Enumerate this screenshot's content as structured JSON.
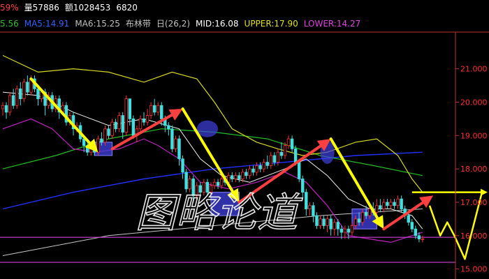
{
  "info": {
    "line1": [
      {
        "text": "59%",
        "color": "#ff4040"
      },
      {
        "text": "量57886",
        "color": "#ffffff"
      },
      {
        "text": "额1028453",
        "color": "#ffffff"
      },
      {
        "text": "6820",
        "color": "#ffffff"
      }
    ],
    "line2": [
      {
        "text": "5.56",
        "color": "#30c030"
      },
      {
        "text": "MA5:14.91",
        "color": "#3060ff"
      },
      {
        "text": "MA6:15.25",
        "color": "#c0c0c0"
      },
      {
        "text": "布林带",
        "color": "#c0c0c0"
      },
      {
        "text": "日(26,2)",
        "color": "#c0c0c0"
      },
      {
        "text": "MID:16.08",
        "color": "#ffffff"
      },
      {
        "text": "UPPER:17.90",
        "color": "#e0e020"
      },
      {
        "text": "LOWER:14.27",
        "color": "#e040e0"
      }
    ]
  },
  "watermark": "图略论道",
  "colors": {
    "background": "#000000",
    "up_candle": "#ff3030",
    "down_candle": "#40e0e0",
    "upper_band": "#d8d820",
    "lower_band": "#c020c0",
    "mid_band": "#f0f0f0",
    "ma_green": "#20c020",
    "ma_blue": "#2030ff",
    "ma_white": "#c8c8c8",
    "support_line": "#d040d0",
    "arrow_yellow": "#ffff00",
    "arrow_red": "#ff4040",
    "box_fill": "#4040e0",
    "axis_text": "#ff3030"
  },
  "chart_data": {
    "type": "candlestick",
    "y_axis": {
      "ticks": [
        {
          "value": 21.0,
          "label": "21.000"
        },
        {
          "value": 20.0,
          "label": "20.000"
        },
        {
          "value": 19.0,
          "label": "19.000"
        },
        {
          "value": 18.0,
          "label": "18.000"
        },
        {
          "value": 17.0,
          "label": "17.000"
        },
        {
          "value": 16.0,
          "label": "16.000"
        },
        {
          "value": 15.0,
          "label": "15.000"
        }
      ],
      "ylim": [
        14.7,
        22.1
      ]
    },
    "n_candles": 120,
    "candles": [
      [
        19.8,
        19.9,
        19.6,
        20.0
      ],
      [
        19.9,
        19.7,
        19.5,
        20.0
      ],
      [
        19.7,
        20.2,
        19.6,
        20.3
      ],
      [
        20.2,
        19.9,
        19.8,
        20.4
      ],
      [
        19.9,
        20.4,
        19.8,
        20.5
      ],
      [
        20.4,
        20.1,
        19.9,
        20.6
      ],
      [
        20.1,
        20.6,
        20.0,
        20.7
      ],
      [
        20.6,
        20.3,
        20.2,
        20.8
      ],
      [
        20.3,
        20.7,
        20.2,
        20.8
      ],
      [
        20.7,
        20.4,
        20.3,
        20.8
      ],
      [
        20.4,
        20.1,
        19.9,
        20.5
      ],
      [
        20.1,
        20.3,
        20.0,
        20.4
      ],
      [
        20.3,
        19.9,
        19.6,
        20.4
      ],
      [
        19.9,
        20.2,
        19.8,
        20.3
      ],
      [
        20.2,
        19.8,
        19.7,
        20.3
      ],
      [
        19.8,
        20.1,
        19.7,
        20.2
      ],
      [
        20.1,
        19.7,
        19.5,
        20.2
      ],
      [
        19.7,
        19.9,
        19.6,
        20.0
      ],
      [
        19.9,
        19.4,
        19.3,
        20.0
      ],
      [
        19.4,
        19.6,
        19.3,
        19.7
      ],
      [
        19.6,
        19.2,
        19.0,
        19.7
      ],
      [
        19.2,
        19.3,
        19.1,
        19.4
      ],
      [
        19.3,
        18.9,
        18.8,
        19.4
      ],
      [
        18.9,
        18.7,
        18.5,
        19.0
      ],
      [
        18.7,
        18.5,
        18.4,
        18.9
      ],
      [
        18.5,
        18.7,
        18.4,
        18.8
      ],
      [
        18.7,
        18.5,
        18.4,
        18.8
      ],
      [
        18.5,
        18.9,
        18.4,
        19.0
      ],
      [
        18.9,
        18.8,
        18.7,
        19.1
      ],
      [
        18.8,
        19.2,
        18.7,
        19.3
      ],
      [
        19.2,
        19.0,
        18.9,
        19.3
      ],
      [
        19.0,
        19.4,
        18.9,
        19.5
      ],
      [
        19.4,
        19.2,
        19.1,
        19.5
      ],
      [
        19.2,
        19.6,
        19.1,
        19.7
      ],
      [
        19.6,
        19.1,
        18.9,
        19.7
      ],
      [
        19.1,
        20.1,
        19.0,
        20.2
      ],
      [
        20.1,
        19.5,
        19.3,
        20.1
      ],
      [
        19.5,
        19.0,
        18.9,
        19.6
      ],
      [
        19.0,
        19.2,
        18.8,
        19.3
      ],
      [
        19.2,
        19.5,
        19.1,
        19.6
      ],
      [
        19.5,
        19.4,
        19.3,
        19.7
      ],
      [
        19.4,
        19.6,
        19.3,
        19.8
      ],
      [
        19.6,
        19.9,
        19.5,
        20.0
      ],
      [
        19.9,
        19.7,
        19.6,
        20.1
      ],
      [
        19.7,
        19.9,
        19.6,
        20.0
      ],
      [
        19.9,
        19.5,
        19.3,
        20.0
      ],
      [
        19.5,
        19.3,
        19.1,
        19.6
      ],
      [
        19.3,
        19.2,
        19.0,
        19.4
      ],
      [
        19.2,
        18.6,
        18.5,
        19.3
      ],
      [
        18.6,
        18.9,
        18.5,
        19.0
      ],
      [
        18.9,
        18.3,
        18.1,
        19.0
      ],
      [
        18.3,
        17.9,
        17.7,
        18.4
      ],
      [
        17.9,
        17.4,
        17.3,
        18.0
      ],
      [
        17.4,
        17.7,
        17.3,
        17.8
      ],
      [
        17.7,
        17.2,
        17.0,
        17.8
      ],
      [
        17.2,
        17.5,
        17.1,
        17.6
      ],
      [
        17.5,
        17.3,
        17.2,
        17.6
      ],
      [
        17.3,
        17.6,
        17.2,
        17.7
      ],
      [
        17.6,
        17.3,
        17.2,
        17.7
      ],
      [
        17.3,
        17.5,
        17.2,
        17.6
      ],
      [
        17.5,
        17.6,
        17.4,
        17.7
      ],
      [
        17.6,
        17.5,
        17.4,
        17.7
      ],
      [
        17.5,
        17.7,
        17.4,
        17.8
      ],
      [
        17.7,
        17.6,
        17.5,
        17.8
      ],
      [
        17.6,
        17.8,
        17.5,
        17.9
      ],
      [
        17.8,
        17.7,
        17.6,
        17.9
      ],
      [
        17.7,
        17.8,
        17.6,
        17.9
      ],
      [
        17.8,
        17.7,
        17.6,
        17.9
      ],
      [
        17.7,
        17.9,
        17.6,
        18.0
      ],
      [
        17.9,
        17.8,
        17.7,
        18.0
      ],
      [
        17.8,
        18.0,
        17.7,
        18.1
      ],
      [
        18.0,
        17.9,
        17.8,
        18.1
      ],
      [
        17.9,
        18.1,
        17.8,
        18.2
      ],
      [
        18.1,
        18.0,
        17.9,
        18.2
      ],
      [
        18.0,
        18.2,
        17.9,
        18.3
      ],
      [
        18.2,
        18.1,
        18.0,
        18.4
      ],
      [
        18.1,
        18.4,
        18.0,
        18.5
      ],
      [
        18.4,
        18.2,
        18.1,
        18.5
      ],
      [
        18.2,
        18.5,
        18.1,
        18.6
      ],
      [
        18.5,
        18.4,
        18.3,
        18.8
      ],
      [
        18.4,
        18.7,
        18.3,
        18.8
      ],
      [
        18.7,
        18.9,
        18.6,
        19.0
      ],
      [
        18.9,
        18.6,
        18.5,
        19.0
      ],
      [
        18.6,
        18.2,
        18.1,
        18.7
      ],
      [
        18.2,
        17.7,
        17.6,
        18.3
      ],
      [
        17.7,
        17.3,
        17.1,
        17.8
      ],
      [
        17.3,
        16.8,
        16.6,
        17.4
      ],
      [
        16.8,
        16.9,
        16.6,
        17.0
      ],
      [
        16.9,
        16.6,
        16.4,
        17.0
      ],
      [
        16.6,
        16.3,
        16.2,
        16.7
      ],
      [
        16.3,
        16.5,
        16.2,
        16.6
      ],
      [
        16.5,
        16.3,
        16.2,
        16.6
      ],
      [
        16.3,
        16.5,
        16.1,
        16.6
      ],
      [
        16.5,
        16.2,
        16.0,
        16.6
      ],
      [
        16.2,
        16.4,
        16.0,
        16.5
      ],
      [
        16.4,
        16.2,
        16.0,
        16.5
      ],
      [
        16.2,
        16.1,
        15.9,
        16.3
      ],
      [
        16.1,
        16.2,
        15.9,
        16.3
      ],
      [
        16.2,
        16.1,
        15.9,
        16.3
      ],
      [
        16.1,
        16.3,
        16.0,
        16.4
      ],
      [
        16.3,
        16.5,
        16.2,
        16.6
      ],
      [
        16.5,
        16.4,
        16.3,
        16.7
      ],
      [
        16.4,
        16.7,
        16.3,
        16.8
      ],
      [
        16.7,
        16.6,
        16.5,
        16.9
      ],
      [
        16.6,
        16.8,
        16.5,
        16.9
      ],
      [
        16.8,
        16.7,
        16.6,
        17.0
      ],
      [
        16.7,
        16.9,
        16.6,
        17.1
      ],
      [
        16.9,
        16.8,
        16.7,
        17.1
      ],
      [
        16.8,
        17.0,
        16.7,
        17.1
      ],
      [
        17.0,
        16.9,
        16.8,
        17.1
      ],
      [
        16.9,
        17.0,
        16.8,
        17.1
      ],
      [
        17.0,
        16.9,
        16.8,
        17.1
      ],
      [
        16.9,
        17.1,
        16.8,
        17.2
      ],
      [
        17.1,
        16.8,
        16.7,
        17.2
      ],
      [
        16.8,
        16.6,
        16.5,
        16.9
      ],
      [
        16.6,
        16.4,
        16.3,
        16.7
      ],
      [
        16.4,
        16.2,
        16.1,
        16.5
      ],
      [
        16.2,
        16.0,
        15.9,
        16.3
      ],
      [
        16.0,
        15.9,
        15.8,
        16.1
      ],
      [
        15.9,
        15.9,
        15.8,
        16.0
      ]
    ],
    "bollinger_upper": [
      [
        0,
        21.4
      ],
      [
        10,
        20.9
      ],
      [
        20,
        21.0
      ],
      [
        30,
        20.9
      ],
      [
        40,
        20.6
      ],
      [
        48,
        20.9
      ],
      [
        55,
        20.7
      ],
      [
        60,
        20.0
      ],
      [
        65,
        19.2
      ],
      [
        72,
        18.8
      ],
      [
        78,
        18.6
      ],
      [
        85,
        18.4
      ],
      [
        92,
        18.5
      ],
      [
        100,
        18.8
      ],
      [
        106,
        18.9
      ],
      [
        112,
        18.4
      ],
      [
        116,
        17.7
      ],
      [
        119,
        17.3
      ]
    ],
    "bollinger_lower": [
      [
        0,
        19.2
      ],
      [
        8,
        19.5
      ],
      [
        14,
        19.2
      ],
      [
        20,
        18.6
      ],
      [
        26,
        18.5
      ],
      [
        33,
        18.6
      ],
      [
        40,
        18.9
      ],
      [
        44,
        18.7
      ],
      [
        50,
        18.3
      ],
      [
        56,
        17.6
      ],
      [
        64,
        17.4
      ],
      [
        72,
        17.6
      ],
      [
        80,
        17.9
      ],
      [
        86,
        17.6
      ],
      [
        92,
        16.9
      ],
      [
        98,
        16.0
      ],
      [
        104,
        15.9
      ],
      [
        110,
        15.8
      ],
      [
        116,
        16.0
      ],
      [
        119,
        16.1
      ]
    ],
    "bollinger_mid": [
      [
        0,
        20.3
      ],
      [
        10,
        20.2
      ],
      [
        20,
        19.7
      ],
      [
        30,
        19.3
      ],
      [
        40,
        19.5
      ],
      [
        50,
        19.2
      ],
      [
        56,
        18.3
      ],
      [
        62,
        17.8
      ],
      [
        70,
        17.6
      ],
      [
        80,
        18.0
      ],
      [
        86,
        18.3
      ],
      [
        92,
        17.8
      ],
      [
        98,
        17.1
      ],
      [
        104,
        16.8
      ],
      [
        110,
        16.8
      ],
      [
        116,
        16.6
      ],
      [
        119,
        16.2
      ]
    ],
    "ma_green": [
      [
        0,
        18.0
      ],
      [
        15,
        18.4
      ],
      [
        30,
        18.9
      ],
      [
        45,
        19.2
      ],
      [
        60,
        19.1
      ],
      [
        75,
        18.9
      ],
      [
        90,
        18.4
      ],
      [
        105,
        18.1
      ],
      [
        119,
        17.8
      ]
    ],
    "ma_blue": [
      [
        0,
        16.8
      ],
      [
        20,
        17.3
      ],
      [
        40,
        17.7
      ],
      [
        60,
        18.0
      ],
      [
        80,
        18.2
      ],
      [
        100,
        18.4
      ],
      [
        119,
        18.5
      ]
    ],
    "ma_white": [
      [
        0,
        15.4
      ],
      [
        30,
        16.0
      ],
      [
        60,
        16.3
      ],
      [
        90,
        16.6
      ],
      [
        119,
        16.8
      ]
    ],
    "support_lines": [
      {
        "value": 15.95,
        "from": 0,
        "to": 119
      },
      {
        "value": 15.2,
        "from": 0,
        "to": 119
      }
    ],
    "boxes": [
      {
        "x0": 26,
        "x1": 31,
        "y0": 18.4,
        "y1": 18.8
      },
      {
        "x0": 59,
        "x1": 67,
        "y0": 16.6,
        "y1": 17.3
      },
      {
        "x0": 99,
        "x1": 106,
        "y0": 16.2,
        "y1": 16.8
      }
    ],
    "ellipses": [
      {
        "cx": 58,
        "cy": 19.2,
        "rx": 3,
        "ry": 0.25
      },
      {
        "cx": 92,
        "cy": 18.5,
        "rx": 2,
        "ry": 0.35
      }
    ],
    "arrows": [
      {
        "color": "yellow",
        "from": [
          8,
          20.7
        ],
        "to": [
          27,
          18.5
        ]
      },
      {
        "color": "red",
        "from": [
          31,
          18.6
        ],
        "to": [
          51,
          19.8
        ]
      },
      {
        "color": "yellow",
        "from": [
          51,
          19.8
        ],
        "to": [
          67,
          17.0
        ]
      },
      {
        "color": "red",
        "from": [
          67,
          17.0
        ],
        "to": [
          93,
          18.9
        ]
      },
      {
        "color": "yellow",
        "from": [
          93,
          18.9
        ],
        "to": [
          108,
          16.2
        ]
      },
      {
        "color": "red",
        "from": [
          108,
          16.2
        ],
        "to": [
          122,
          17.2
        ]
      }
    ],
    "projection": {
      "horizontal": {
        "value": 17.3,
        "from": 116,
        "to": 140
      },
      "path": [
        [
          121,
          16.9
        ],
        [
          124,
          16.0
        ],
        [
          126,
          16.4
        ],
        [
          128,
          16.0
        ],
        [
          131,
          15.3
        ],
        [
          136,
          17.3
        ],
        [
          140,
          17.3
        ]
      ]
    }
  }
}
